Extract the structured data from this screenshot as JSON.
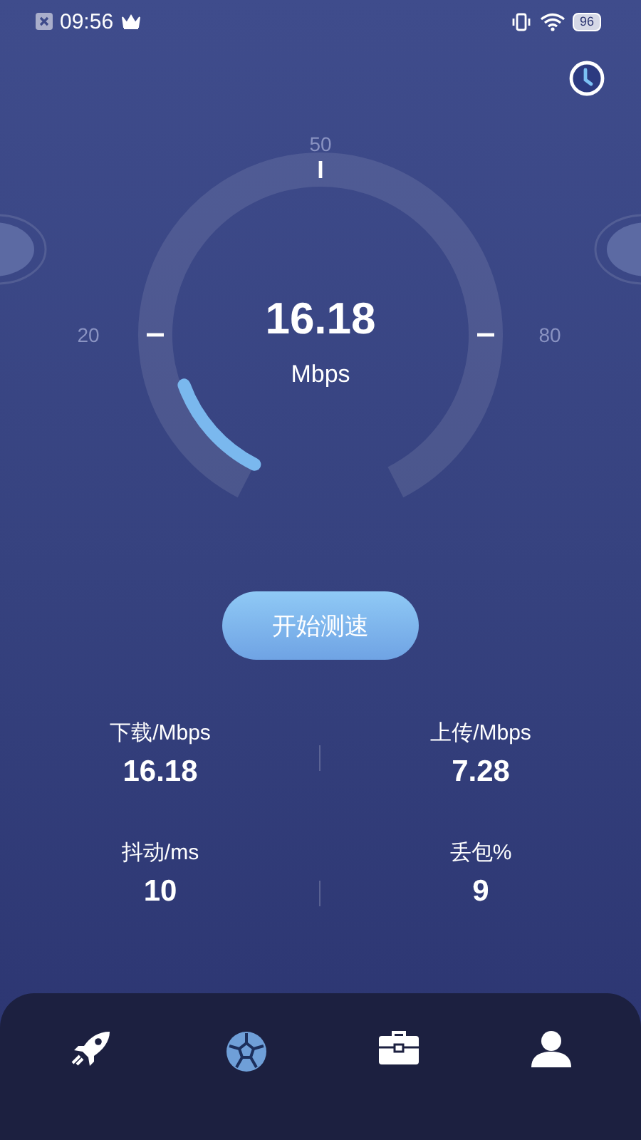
{
  "status_bar": {
    "time": "09:56",
    "battery": "96"
  },
  "gauge": {
    "reading": "16.18",
    "unit": "Mbps",
    "level": 0.14,
    "scale_labels": [
      "20",
      "50",
      "80"
    ]
  },
  "start_button": {
    "label": "开始测速"
  },
  "stats": [
    {
      "label": "下载/Mbps",
      "value": "16.18"
    },
    {
      "label": "上传/Mbps",
      "value": "7.28"
    },
    {
      "label": "抖动/ms",
      "value": "10"
    },
    {
      "label": "丢包%",
      "value": "9"
    }
  ],
  "nav": [
    {
      "kind": "rocket",
      "selected": false
    },
    {
      "kind": "globe",
      "selected": true
    },
    {
      "kind": "briefcase",
      "selected": false
    },
    {
      "kind": "person",
      "selected": false
    }
  ]
}
